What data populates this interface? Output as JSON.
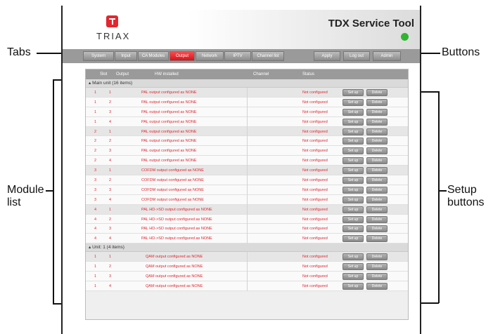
{
  "annotations": {
    "tabs": "Tabs",
    "buttons": "Buttons",
    "module_list_line1": "Module",
    "module_list_line2": "list",
    "setup_line1": "Setup",
    "setup_line2": "buttons"
  },
  "header": {
    "logo_text": "TRIAX",
    "title": "TDX Service Tool",
    "status_color": "#2fb52f"
  },
  "tabs": [
    {
      "label": "System"
    },
    {
      "label": "Input"
    },
    {
      "label": "CA Modules"
    },
    {
      "label": "Output",
      "active": true
    },
    {
      "label": "Network"
    },
    {
      "label": "IPTV"
    },
    {
      "label": "Channel list"
    }
  ],
  "actions": [
    {
      "label": "Apply"
    },
    {
      "label": "Log out"
    },
    {
      "label": "Admin"
    }
  ],
  "columns": {
    "slot": "Slot",
    "output": "Output",
    "hw": "HW installed",
    "channel": "Channel",
    "status": "Status"
  },
  "groups": [
    {
      "title": "Main unit (16 items)",
      "rows": [
        {
          "slot": "1",
          "output": "1",
          "hw": "PAL output configured as NONE",
          "status": "Not configured",
          "setup": "Set up",
          "delete": "Delete"
        },
        {
          "slot": "1",
          "output": "2",
          "hw": "PAL output configured as NONE",
          "status": "Not configured",
          "setup": "Set up",
          "delete": "Delete"
        },
        {
          "slot": "1",
          "output": "3",
          "hw": "PAL output configured as NONE",
          "status": "Not configured",
          "setup": "Set up",
          "delete": "Delete"
        },
        {
          "slot": "1",
          "output": "4",
          "hw": "PAL output configured as NONE",
          "status": "Not configured",
          "setup": "Set up",
          "delete": "Delete"
        },
        {
          "slot": "2",
          "output": "1",
          "hw": "PAL output configured as NONE",
          "status": "Not configured",
          "setup": "Set up",
          "delete": "Delete"
        },
        {
          "slot": "2",
          "output": "2",
          "hw": "PAL output configured as NONE",
          "status": "Not configured",
          "setup": "Set up",
          "delete": "Delete"
        },
        {
          "slot": "2",
          "output": "3",
          "hw": "PAL output configured as NONE",
          "status": "Not configured",
          "setup": "Set up",
          "delete": "Delete"
        },
        {
          "slot": "2",
          "output": "4",
          "hw": "PAL output configured as NONE",
          "status": "Not configured",
          "setup": "Set up",
          "delete": "Delete"
        },
        {
          "slot": "3",
          "output": "1",
          "hw": "COFDM output configured as NONE",
          "status": "Not configured",
          "setup": "Set up",
          "delete": "Delete"
        },
        {
          "slot": "3",
          "output": "2",
          "hw": "COFDM output configured as NONE",
          "status": "Not configured",
          "setup": "Set up",
          "delete": "Delete"
        },
        {
          "slot": "3",
          "output": "3",
          "hw": "COFDM output configured as NONE",
          "status": "Not configured",
          "setup": "Set up",
          "delete": "Delete"
        },
        {
          "slot": "3",
          "output": "4",
          "hw": "COFDM output configured as NONE",
          "status": "Not configured",
          "setup": "Set up",
          "delete": "Delete"
        },
        {
          "slot": "4",
          "output": "1",
          "hw": "PAL HD->SD output configured as NONE",
          "status": "Not configured",
          "setup": "Set up",
          "delete": "Delete"
        },
        {
          "slot": "4",
          "output": "2",
          "hw": "PAL HD->SD output configured as NONE",
          "status": "Not configured",
          "setup": "Set up",
          "delete": "Delete"
        },
        {
          "slot": "4",
          "output": "3",
          "hw": "PAL HD->SD output configured as NONE",
          "status": "Not configured",
          "setup": "Set up",
          "delete": "Delete"
        },
        {
          "slot": "4",
          "output": "4",
          "hw": "PAL HD->SD output configured as NONE",
          "status": "Not configured",
          "setup": "Set up",
          "delete": "Delete"
        }
      ]
    },
    {
      "title": "Unit: 1 (4 items)",
      "rows": [
        {
          "slot": "1",
          "output": "1",
          "hw": "QAM output configured as NONE",
          "status": "Not configured",
          "setup": "Set up",
          "delete": "Delete"
        },
        {
          "slot": "1",
          "output": "2",
          "hw": "QAM output configured as NONE",
          "status": "Not configured",
          "setup": "Set up",
          "delete": "Delete"
        },
        {
          "slot": "1",
          "output": "3",
          "hw": "QAM output configured as NONE",
          "status": "Not configured",
          "setup": "Set up",
          "delete": "Delete"
        },
        {
          "slot": "1",
          "output": "4",
          "hw": "QAM output configured as NONE",
          "status": "Not configured",
          "setup": "Set up",
          "delete": "Delete"
        }
      ]
    }
  ]
}
